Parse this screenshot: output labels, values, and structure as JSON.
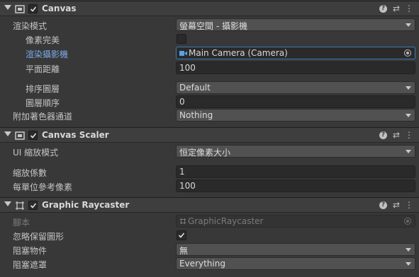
{
  "canvas": {
    "title": "Canvas",
    "render_mode_label": "渲染模式",
    "render_mode_value": "螢幕空間 - 攝影機",
    "pixel_perfect_label": "像素完美",
    "render_camera_label": "渲染攝影機",
    "render_camera_value": "Main Camera (Camera)",
    "plane_distance_label": "平面距離",
    "plane_distance_value": "100",
    "sorting_layer_label": "排序圖層",
    "sorting_layer_value": "Default",
    "order_in_layer_label": "圖層順序",
    "order_in_layer_value": "0",
    "shader_channels_label": "附加著色器通道",
    "shader_channels_value": "Nothing"
  },
  "canvas_scaler": {
    "title": "Canvas Scaler",
    "ui_scale_mode_label": "UI 縮放模式",
    "ui_scale_mode_value": "恒定像素大小",
    "scale_factor_label": "縮放係數",
    "scale_factor_value": "1",
    "ref_pixels_label": "每單位參考像素",
    "ref_pixels_value": "100"
  },
  "graphic_raycaster": {
    "title": "Graphic Raycaster",
    "script_label": "腳本",
    "script_value": "GraphicRaycaster",
    "ignore_reversed_label": "忽略保留圖形",
    "ignore_reversed_checked": true,
    "blocking_objects_label": "阻塞物件",
    "blocking_objects_value": "無",
    "blocking_mask_label": "阻塞遮罩",
    "blocking_mask_value": "Everything"
  },
  "header_buttons": {
    "help": "?",
    "preset": "⇄",
    "menu": "⋮"
  },
  "colors": {
    "background": "#383838",
    "header": "#3e3e3e",
    "link_label": "#7ba9e6",
    "focus": "#3a79bb"
  }
}
